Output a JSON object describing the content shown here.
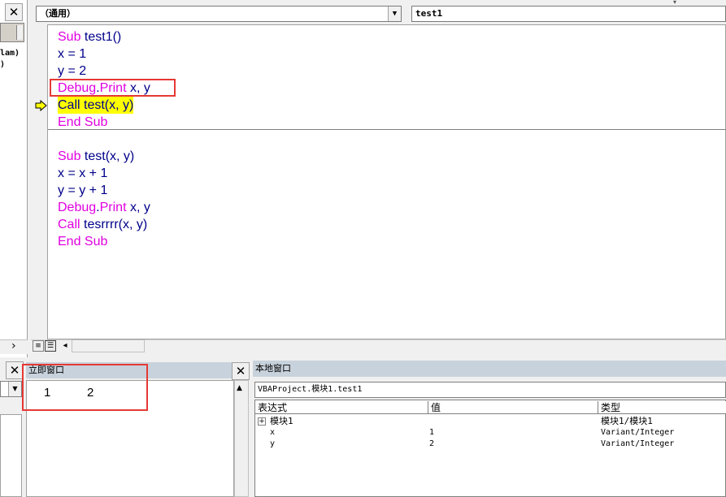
{
  "left_panel": {
    "line1": "lam)",
    "line2": ")",
    "scroll_arrow": "›"
  },
  "code_window": {
    "object_combo": "（通用）",
    "proc_combo": "test1",
    "lines_proc1": [
      {
        "kw1": "Sub",
        "text": " test1()"
      },
      {
        "text": "x = 1"
      },
      {
        "text": "y = 2"
      },
      {
        "kw1": "Debug",
        "mid": ".",
        "kw2": "Print",
        "text": " x, y"
      },
      {
        "text": "Call test(x, y)"
      },
      {
        "kw1": "End Sub"
      }
    ],
    "lines_proc2": [
      {
        "kw1": "Sub",
        "text": " test(x, y)"
      },
      {
        "text": "x = x + 1"
      },
      {
        "text": "y = y + 1"
      },
      {
        "kw1": "Debug",
        "mid": ".",
        "kw2": "Print",
        "text": " x, y"
      },
      {
        "kw1": "Call",
        "text": " tesrrrr(x, y)"
      },
      {
        "kw1": "End Sub"
      }
    ]
  },
  "immediate_window": {
    "title": "立即窗口",
    "output_a": "1",
    "output_b": "2"
  },
  "locals_window": {
    "title": "本地窗口",
    "context": "VBAProject.模块1.test1",
    "headers": [
      "表达式",
      "值",
      "类型"
    ],
    "rows": [
      {
        "expr": "模块1",
        "value": "",
        "type": "模块1/模块1"
      },
      {
        "expr": "x",
        "value": "1",
        "type": "Variant/Integer"
      },
      {
        "expr": "y",
        "value": "2",
        "type": "Variant/Integer"
      }
    ]
  },
  "colors": {
    "keyword": "#e000e0",
    "identifier": "#00008b",
    "exec_highlight": "#ffff00",
    "annotation": "#e53935"
  }
}
